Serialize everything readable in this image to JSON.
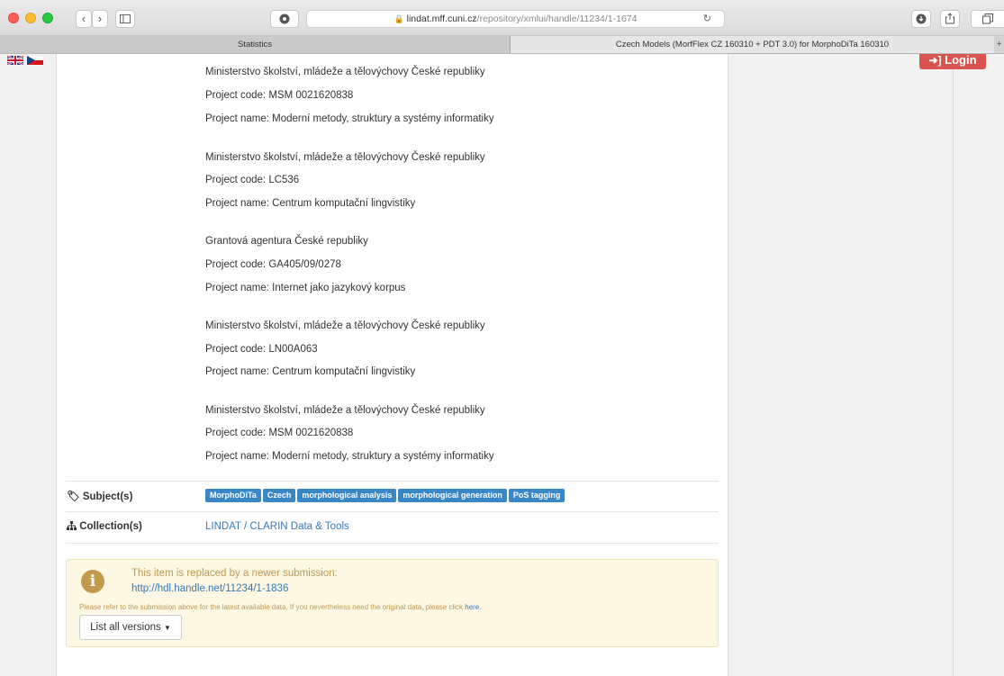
{
  "browser": {
    "url_host": "lindat.mff.cuni.cz",
    "url_path": "/repository/xmlui/handle/11234/1-1674",
    "tabs": [
      {
        "label": "Statistics"
      },
      {
        "label": "Czech Models (MorfFlex CZ 160310 + PDT 3.0) for MorphoDiTa 160310"
      }
    ]
  },
  "header": {
    "login_label": "Login"
  },
  "funding": [
    {
      "line": "Ministerstvo školství, mládeže a tělovýchovy České republiky"
    },
    {
      "line": "Project code: MSM 0021620838"
    },
    {
      "line": "Project name: Moderní metody, struktury a systémy informatiky"
    },
    {
      "line": "Ministerstvo školství, mládeže a tělovýchovy České republiky"
    },
    {
      "line": "Project code: LC536"
    },
    {
      "line": "Project name: Centrum komputační lingvistiky"
    },
    {
      "line": "Grantová agentura České republiky"
    },
    {
      "line": "Project code: GA405/09/0278"
    },
    {
      "line": "Project name: Internet jako jazykový korpus"
    },
    {
      "line": "Ministerstvo školství, mládeže a tělovýchovy České republiky"
    },
    {
      "line": "Project code: LN00A063"
    },
    {
      "line": "Project name: Centrum komputační lingvistiky"
    },
    {
      "line": "Ministerstvo školství, mládeže a tělovýchovy České republiky"
    },
    {
      "line": "Project code: MSM 0021620838"
    },
    {
      "line": "Project name: Moderní metody, struktury a systémy informatiky"
    }
  ],
  "subjects": {
    "label": "Subject(s)",
    "tags": [
      "MorphoDiTa",
      "Czech",
      "morphological analysis",
      "morphological generation",
      "PoS tagging"
    ]
  },
  "collection": {
    "label": "Collection(s)",
    "value": "LINDAT / CLARIN Data & Tools"
  },
  "alert": {
    "title": "This item is replaced by a newer submission:",
    "link": "http://hdl.handle.net/11234/1-1836",
    "note_text": "Please refer to the submission above for the latest available data. If you nevertheless need the original data, please click",
    "note_link": "here",
    "note_end": ".",
    "button_label": "List all versions"
  },
  "colors": {
    "accent": "#3a87c8",
    "login": "#d9534f",
    "alert_bg": "#fcf8e3",
    "alert_text": "#c09853"
  }
}
